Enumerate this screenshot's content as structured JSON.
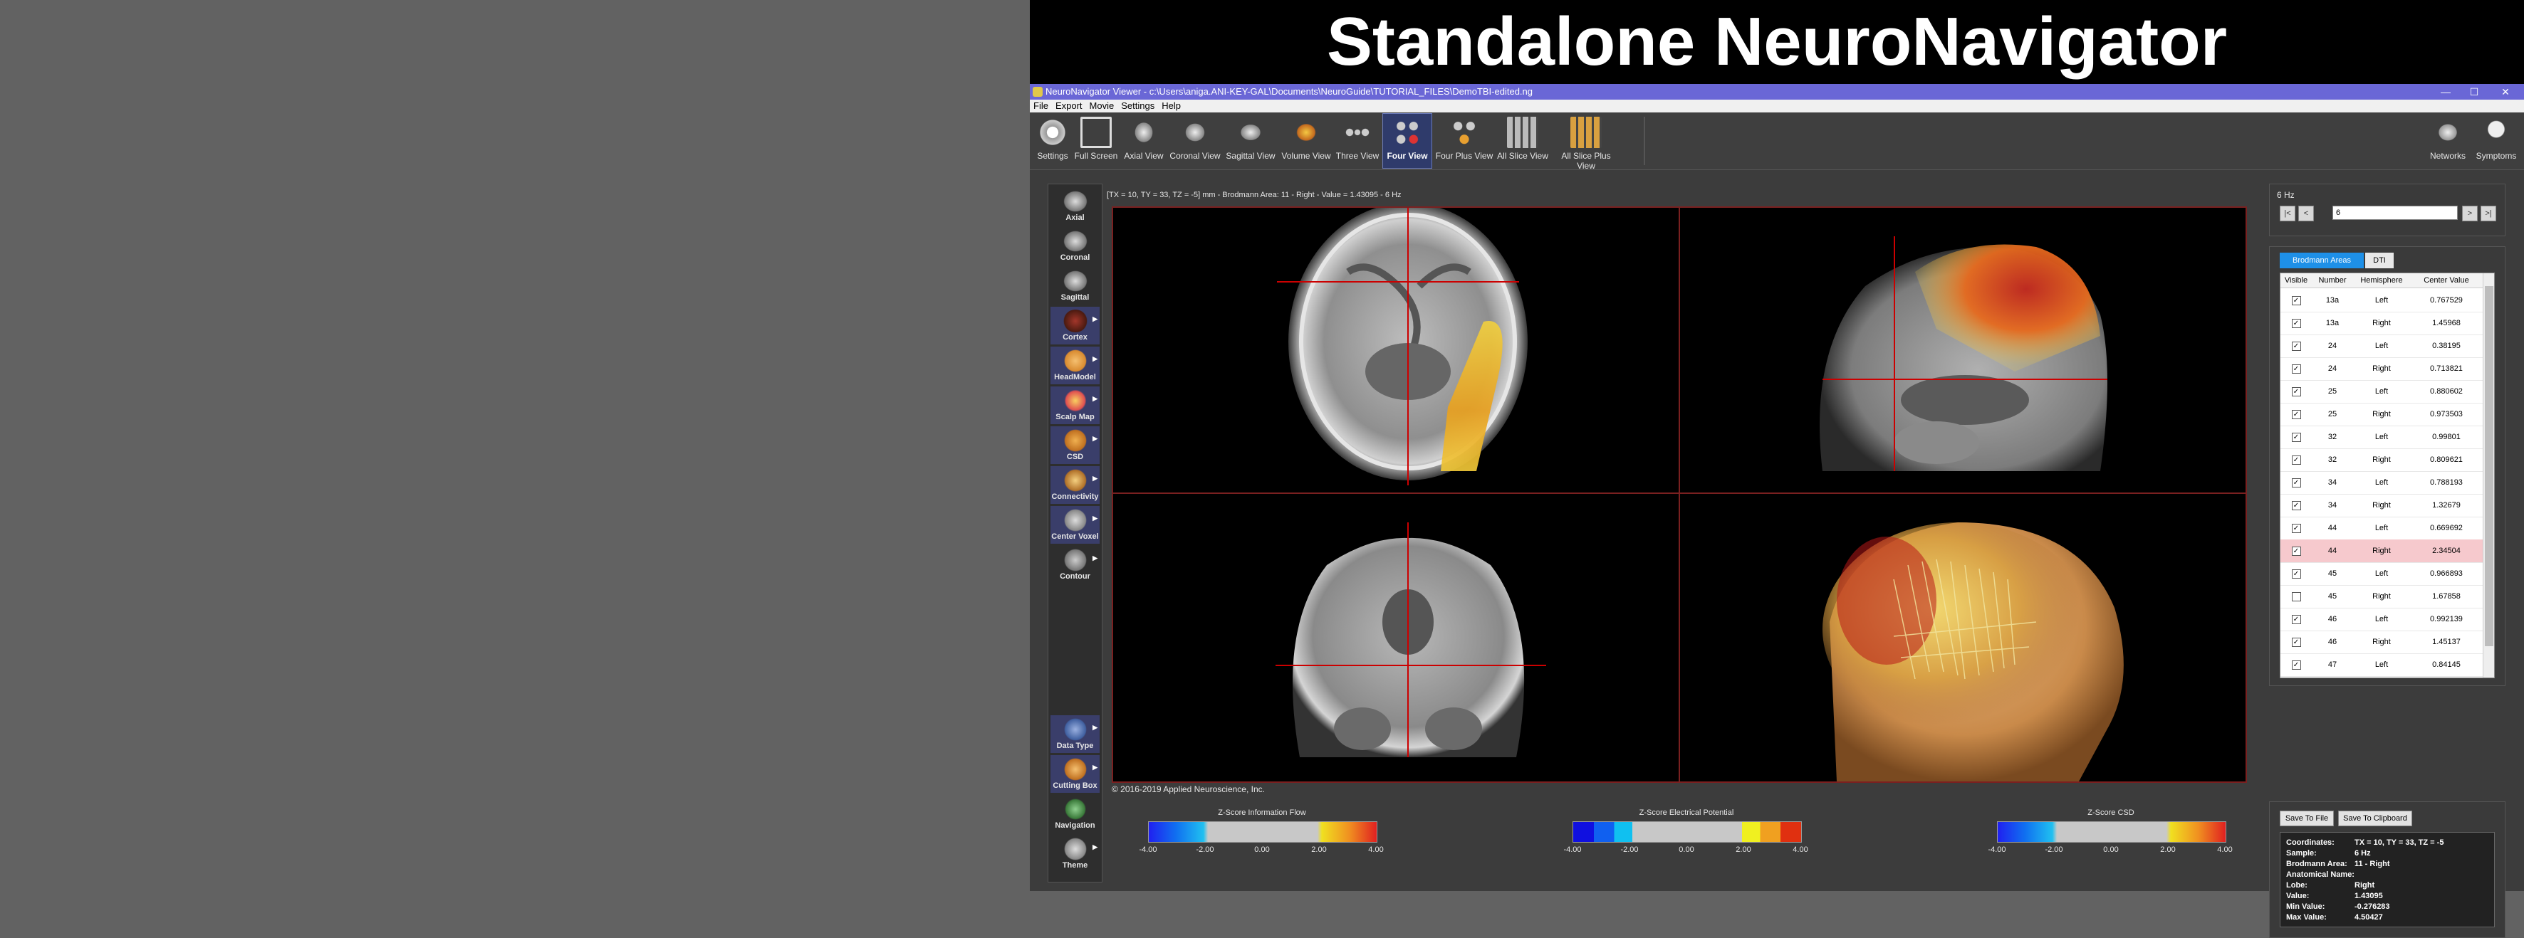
{
  "headline": "Standalone NeuroNavigator",
  "window": {
    "title": "NeuroNavigator Viewer - c:\\Users\\aniga.ANI-KEY-GAL\\Documents\\NeuroGuide\\TUTORIAL_FILES\\DemoTBI-edited.ng",
    "min": "—",
    "max": "☐",
    "close": "✕"
  },
  "menu": [
    "File",
    "Export",
    "Movie",
    "Settings",
    "Help"
  ],
  "toolbar": {
    "items": [
      {
        "label": "Settings",
        "icon": "gear-icon"
      },
      {
        "label": "Full Screen",
        "icon": "fullscreen-icon"
      },
      {
        "label": "Axial View",
        "icon": "axial-brain-icon"
      },
      {
        "label": "Coronal View",
        "icon": "coronal-brain-icon"
      },
      {
        "label": "Sagittal View",
        "icon": "sagittal-brain-icon"
      },
      {
        "label": "Volume View",
        "icon": "volume-icon"
      },
      {
        "label": "Three View",
        "icon": "three-view-icon"
      },
      {
        "label": "Four View",
        "icon": "four-view-icon",
        "active": true
      },
      {
        "label": "Four Plus View",
        "icon": "four-plus-view-icon"
      },
      {
        "label": "All Slice View",
        "icon": "all-slice-icon"
      },
      {
        "label": "All Slice Plus View",
        "icon": "all-slice-plus-icon"
      }
    ],
    "right": [
      {
        "label": "Networks",
        "icon": "networks-icon"
      },
      {
        "label": "Symptoms",
        "icon": "symptoms-icon"
      }
    ]
  },
  "sidebar": {
    "items": [
      {
        "label": "Axial",
        "icon": "axial-slice-icon"
      },
      {
        "label": "Coronal",
        "icon": "coronal-slice-icon"
      },
      {
        "label": "Sagittal",
        "icon": "sagittal-slice-icon"
      },
      {
        "label": "Cortex",
        "icon": "cortex-icon"
      },
      {
        "label": "HeadModel",
        "icon": "head-model-icon"
      },
      {
        "label": "Scalp Map",
        "icon": "scalp-map-icon"
      },
      {
        "label": "CSD",
        "icon": "csd-icon"
      },
      {
        "label": "Connectivity",
        "icon": "connectivity-icon"
      },
      {
        "label": "Center Voxel",
        "icon": "center-voxel-icon"
      },
      {
        "label": "Contour",
        "icon": "contour-icon"
      }
    ],
    "bottom": [
      {
        "label": "Data Type",
        "icon": "data-type-icon"
      },
      {
        "label": "Cutting Box",
        "icon": "cutting-box-icon"
      },
      {
        "label": "Navigation",
        "icon": "navigation-icon"
      },
      {
        "label": "Theme",
        "icon": "theme-icon"
      }
    ]
  },
  "status_line": "[TX = 10, TY = 33, TZ = -5] mm - Brodmann Area: 11 - Right - Value = 1.43095 - 6 Hz",
  "copyright": "© 2016-2019 Applied Neuroscience, Inc.",
  "colorbars": [
    {
      "title": "Z-Score Information Flow",
      "ticks": [
        "-4.00",
        "-2.00",
        "0.00",
        "2.00",
        "4.00"
      ]
    },
    {
      "title": "Z-Score Electrical Potential",
      "ticks": [
        "-4.00",
        "-2.00",
        "0.00",
        "2.00",
        "4.00"
      ]
    },
    {
      "title": "Z-Score CSD",
      "ticks": [
        "-4.00",
        "-2.00",
        "0.00",
        "2.00",
        "4.00"
      ]
    }
  ],
  "frequency": {
    "label": "6 Hz",
    "value": "6",
    "buttons": {
      "first": "|<",
      "prev": "<",
      "next": ">",
      "last": ">|"
    }
  },
  "tabs": [
    {
      "label": "Brodmann Areas",
      "active": true
    },
    {
      "label": "DTI",
      "active": false
    }
  ],
  "table": {
    "headers": [
      "Visible",
      "Number",
      "Hemisphere",
      "Center Value"
    ],
    "rows": [
      {
        "visible": true,
        "number": "13a",
        "hemisphere": "Left",
        "value": "0.767529"
      },
      {
        "visible": true,
        "number": "13a",
        "hemisphere": "Right",
        "value": "1.45968"
      },
      {
        "visible": true,
        "number": "24",
        "hemisphere": "Left",
        "value": "0.38195"
      },
      {
        "visible": true,
        "number": "24",
        "hemisphere": "Right",
        "value": "0.713821"
      },
      {
        "visible": true,
        "number": "25",
        "hemisphere": "Left",
        "value": "0.880602"
      },
      {
        "visible": true,
        "number": "25",
        "hemisphere": "Right",
        "value": "0.973503"
      },
      {
        "visible": true,
        "number": "32",
        "hemisphere": "Left",
        "value": "0.99801"
      },
      {
        "visible": true,
        "number": "32",
        "hemisphere": "Right",
        "value": "0.809621"
      },
      {
        "visible": true,
        "number": "34",
        "hemisphere": "Left",
        "value": "0.788193"
      },
      {
        "visible": true,
        "number": "34",
        "hemisphere": "Right",
        "value": "1.32679"
      },
      {
        "visible": true,
        "number": "44",
        "hemisphere": "Left",
        "value": "0.669692"
      },
      {
        "visible": true,
        "number": "44",
        "hemisphere": "Right",
        "value": "2.34504",
        "highlight": true
      },
      {
        "visible": true,
        "number": "45",
        "hemisphere": "Left",
        "value": "0.966893"
      },
      {
        "visible": false,
        "number": "45",
        "hemisphere": "Right",
        "value": "1.67858"
      },
      {
        "visible": true,
        "number": "46",
        "hemisphere": "Left",
        "value": "0.992139"
      },
      {
        "visible": true,
        "number": "46",
        "hemisphere": "Right",
        "value": "1.45137"
      },
      {
        "visible": true,
        "number": "47",
        "hemisphere": "Left",
        "value": "0.84145"
      }
    ]
  },
  "buttons": {
    "save_file": "Save To File",
    "save_clipboard": "Save To Clipboard"
  },
  "info": [
    {
      "key": "Coordinates:",
      "value": "TX = 10, TY = 33, TZ = -5"
    },
    {
      "key": "Sample:",
      "value": "6 Hz"
    },
    {
      "key": "Brodmann Area:",
      "value": "11 - Right"
    },
    {
      "key": "Anatomical Name:",
      "value": ""
    },
    {
      "key": "Lobe:",
      "value": "Right"
    },
    {
      "key": "Value:",
      "value": "1.43095"
    },
    {
      "key": "Min Value:",
      "value": "-0.276283"
    },
    {
      "key": "Max Value:",
      "value": "4.50427"
    }
  ],
  "colors": {
    "titlebar": "#6a67d6",
    "highlight_row": "#f6c9cd",
    "crosshair": "#cc0000",
    "active_tab": "#1e90e8"
  }
}
